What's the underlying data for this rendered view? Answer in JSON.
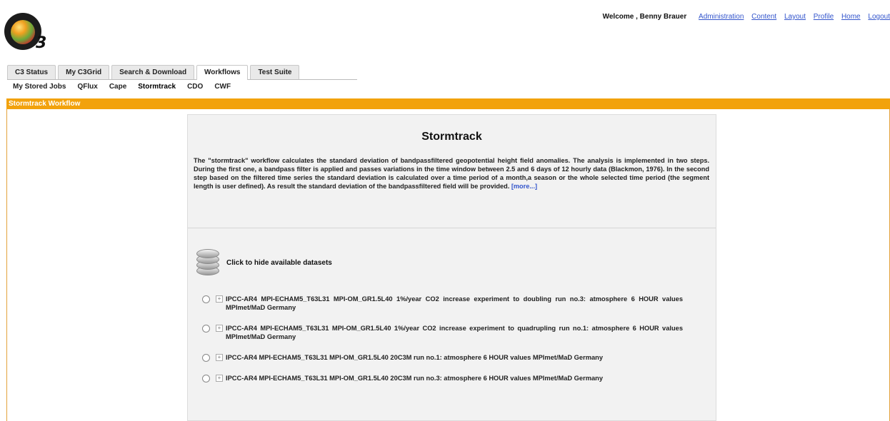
{
  "header": {
    "logo_text": "3",
    "welcome": "Welcome , Benny Brauer",
    "links": [
      "Administration",
      "Content",
      "Layout",
      "Profile",
      "Home",
      "Logout"
    ]
  },
  "tabs": [
    {
      "label": "C3 Status",
      "active": false
    },
    {
      "label": "My C3Grid",
      "active": false
    },
    {
      "label": "Search & Download",
      "active": false
    },
    {
      "label": "Workflows",
      "active": true
    },
    {
      "label": "Test Suite",
      "active": false
    }
  ],
  "subtabs": [
    {
      "label": "My Stored Jobs",
      "active": false
    },
    {
      "label": "QFlux",
      "active": false
    },
    {
      "label": "Cape",
      "active": false
    },
    {
      "label": "Stormtrack",
      "active": true
    },
    {
      "label": "CDO",
      "active": false
    },
    {
      "label": "CWF",
      "active": false
    }
  ],
  "section_bar": "Stormtrack Workflow",
  "colors": {
    "accent": "#f2a20c",
    "link": "#3355cc"
  },
  "panel": {
    "title": "Stormtrack",
    "description": "The \"stormtrack\" workflow calculates the standard deviation of bandpassfiltered geopotential height field anomalies. The analysis is implemented in two steps. During the first one, a bandpass filter is applied and passes variations in the time window between 2.5 and 6 days of 12 hourly data (Blackmon, 1976). In the second step based on the filtered time series the standard deviation is calculated over a time period of a month,a season or the whole selected time period (the segment length is user defined). As result the standard deviation of the bandpassfiltered field will be provided.",
    "more_link": "[more...]",
    "toggle_label": "Click to hide available datasets",
    "toggle_icon": "database-icon"
  },
  "datasets": [
    "IPCC-AR4 MPI-ECHAM5_T63L31 MPI-OM_GR1.5L40 1%/year CO2 increase experiment to doubling run no.3: atmosphere 6 HOUR values MPImet/MaD Germany",
    "IPCC-AR4 MPI-ECHAM5_T63L31 MPI-OM_GR1.5L40 1%/year CO2 increase experiment to quadrupling run no.1: atmosphere 6 HOUR values MPImet/MaD Germany",
    "IPCC-AR4 MPI-ECHAM5_T63L31 MPI-OM_GR1.5L40 20C3M run no.1: atmosphere 6 HOUR values MPImet/MaD Germany",
    "IPCC-AR4 MPI-ECHAM5_T63L31 MPI-OM_GR1.5L40 20C3M run no.3: atmosphere 6 HOUR values MPImet/MaD Germany"
  ]
}
